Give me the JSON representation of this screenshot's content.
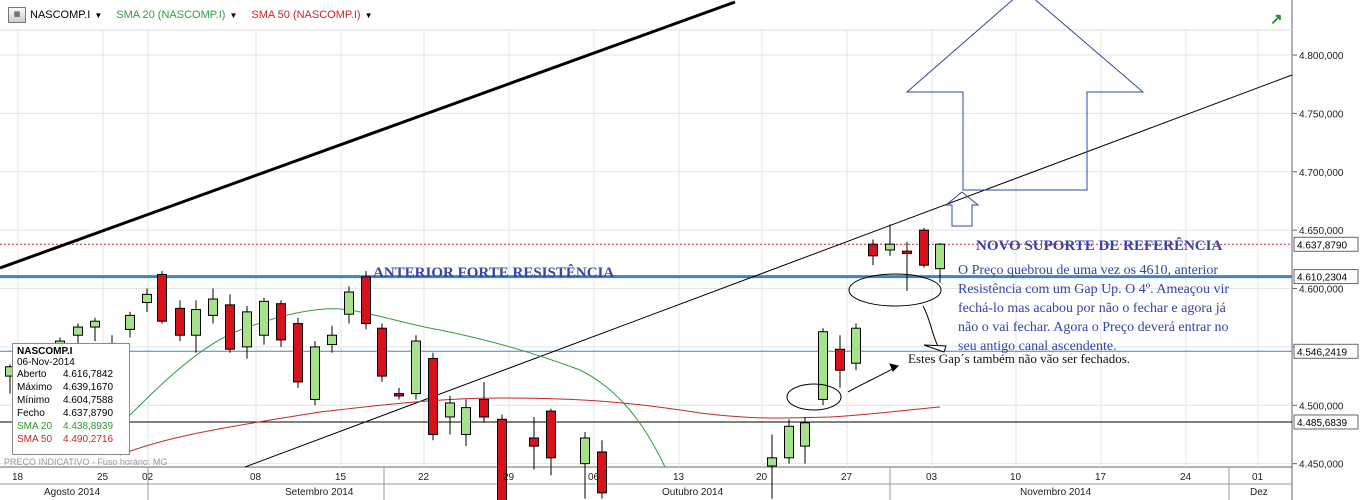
{
  "toolbar": {
    "icon": "chart-app-icon",
    "symbol": "NASCOMP.I",
    "sma20": "SMA 20 (NASCOMP.I)",
    "sma50": "SMA 50 (NASCOMP.I)"
  },
  "info": {
    "title": "NASCOMP.I",
    "date": "06-Nov-2014",
    "rows": [
      {
        "k": "Aberto",
        "v": "4.616,7842"
      },
      {
        "k": "Máximo",
        "v": "4.639,1670"
      },
      {
        "k": "Mínimo",
        "v": "4.604,7588"
      },
      {
        "k": "Fecho",
        "v": "4.637,8790"
      },
      {
        "k": "SMA 20",
        "v": "4.438,8939"
      },
      {
        "k": "SMA 50",
        "v": "4.490,2716"
      }
    ],
    "indicative": "PREÇO INDICATIVO - Fuso horário: MG"
  },
  "annotations": {
    "new_support": "NOVO SUPORTE DE REFERÊNCIA",
    "old_resistance": "ANTERIOR FORTE RESISTÊNCIA",
    "paragraph": [
      "O Preço quebrou de uma vez os 4610, anterior",
      "Resistência com um Gap Up. O 4º. Ameaçou vir",
      "fechá-lo mas acabou por não o fechar e agora já",
      "não o vai fechar. Agora o Preço deverá entrar no",
      "seu antigo canal ascendente."
    ],
    "gaps_note": "Estes Gap´s também não vão ser fechados."
  },
  "colors": {
    "up_fill": "#a6e28a",
    "down_fill": "#d8121b",
    "sma20": "#2e9e3e",
    "sma50": "#c62828",
    "blue_lines": "#3f85c4",
    "arrow": "#3344aa"
  },
  "chart_data": {
    "type": "candlestick",
    "x_labels": [
      "18",
      "25",
      "02",
      "08",
      "15",
      "22",
      "29",
      "06",
      "13",
      "20",
      "27",
      "03",
      "10",
      "17",
      "24",
      "01"
    ],
    "months": [
      "Agosto 2014",
      "Setembro 2014",
      "Outubro 2014",
      "Novembro 2014",
      "Dez"
    ],
    "ylim": [
      4430,
      4830
    ],
    "y_ticks": [
      "4.800,000",
      "4.750,000",
      "4.700,000",
      "4.650,000",
      "4.600,000",
      "4.550,000",
      "4.500,000",
      "4.450,000"
    ],
    "price_labels": [
      "4.637,8790",
      "4.610,2304",
      "4.546,2419",
      "4.485,6839"
    ],
    "candles": [
      {
        "o": 4525,
        "h": 4535,
        "l": 4510,
        "c": 4533
      },
      {
        "o": 4548,
        "h": 4558,
        "l": 4538,
        "c": 4555
      },
      {
        "o": 4560,
        "h": 4570,
        "l": 4552,
        "c": 4567
      },
      {
        "o": 4567,
        "h": 4575,
        "l": 4555,
        "c": 4572
      },
      {
        "o": 4547,
        "h": 4560,
        "l": 4540,
        "c": 4553
      },
      {
        "o": 4565,
        "h": 4580,
        "l": 4558,
        "c": 4577
      },
      {
        "o": 4588,
        "h": 4600,
        "l": 4580,
        "c": 4595
      },
      {
        "o": 4612,
        "h": 4615,
        "l": 4570,
        "c": 4572
      },
      {
        "o": 4583,
        "h": 4590,
        "l": 4555,
        "c": 4560
      },
      {
        "o": 4560,
        "h": 4590,
        "l": 4545,
        "c": 4582
      },
      {
        "o": 4577,
        "h": 4600,
        "l": 4570,
        "c": 4591
      },
      {
        "o": 4586,
        "h": 4595,
        "l": 4545,
        "c": 4548
      },
      {
        "o": 4550,
        "h": 4585,
        "l": 4540,
        "c": 4580
      },
      {
        "o": 4560,
        "h": 4592,
        "l": 4552,
        "c": 4589
      },
      {
        "o": 4587,
        "h": 4590,
        "l": 4550,
        "c": 4556
      },
      {
        "o": 4570,
        "h": 4575,
        "l": 4515,
        "c": 4520
      },
      {
        "o": 4505,
        "h": 4555,
        "l": 4500,
        "c": 4550
      },
      {
        "o": 4552,
        "h": 4568,
        "l": 4545,
        "c": 4560
      },
      {
        "o": 4578,
        "h": 4602,
        "l": 4570,
        "c": 4597
      },
      {
        "o": 4610,
        "h": 4615,
        "l": 4565,
        "c": 4570
      },
      {
        "o": 4566,
        "h": 4570,
        "l": 4520,
        "c": 4525
      },
      {
        "o": 4510,
        "h": 4515,
        "l": 4505,
        "c": 4508
      },
      {
        "o": 4510,
        "h": 4560,
        "l": 4505,
        "c": 4555
      },
      {
        "o": 4540,
        "h": 4545,
        "l": 4470,
        "c": 4475
      },
      {
        "o": 4490,
        "h": 4508,
        "l": 4475,
        "c": 4502
      },
      {
        "o": 4475,
        "h": 4505,
        "l": 4465,
        "c": 4498
      },
      {
        "o": 4505,
        "h": 4520,
        "l": 4485,
        "c": 4490
      },
      {
        "o": 4488,
        "h": 4492,
        "l": 4400,
        "c": 4405
      },
      {
        "o": 4472,
        "h": 4490,
        "l": 4445,
        "c": 4465
      },
      {
        "o": 4495,
        "h": 4497,
        "l": 4440,
        "c": 4455
      },
      {
        "o": 4450,
        "h": 4477,
        "l": 4420,
        "c": 4472
      },
      {
        "o": 4460,
        "h": 4470,
        "l": 4420,
        "c": 4425
      },
      {
        "o": 4448,
        "h": 4475,
        "l": 4420,
        "c": 4455
      },
      {
        "o": 4455,
        "h": 4488,
        "l": 4450,
        "c": 4482
      },
      {
        "o": 4465,
        "h": 4490,
        "l": 4450,
        "c": 4485
      },
      {
        "o": 4505,
        "h": 4566,
        "l": 4500,
        "c": 4563
      },
      {
        "o": 4548,
        "h": 4560,
        "l": 4515,
        "c": 4530
      },
      {
        "o": 4536,
        "h": 4570,
        "l": 4530,
        "c": 4566
      },
      {
        "o": 4638,
        "h": 4642,
        "l": 4620,
        "c": 4628
      },
      {
        "o": 4633,
        "h": 4655,
        "l": 4628,
        "c": 4638
      },
      {
        "o": 4632,
        "h": 4640,
        "l": 4598,
        "c": 4630
      },
      {
        "o": 4650,
        "h": 4652,
        "l": 4618,
        "c": 4620
      },
      {
        "o": 4617,
        "h": 4639,
        "l": 4605,
        "c": 4638
      }
    ]
  }
}
